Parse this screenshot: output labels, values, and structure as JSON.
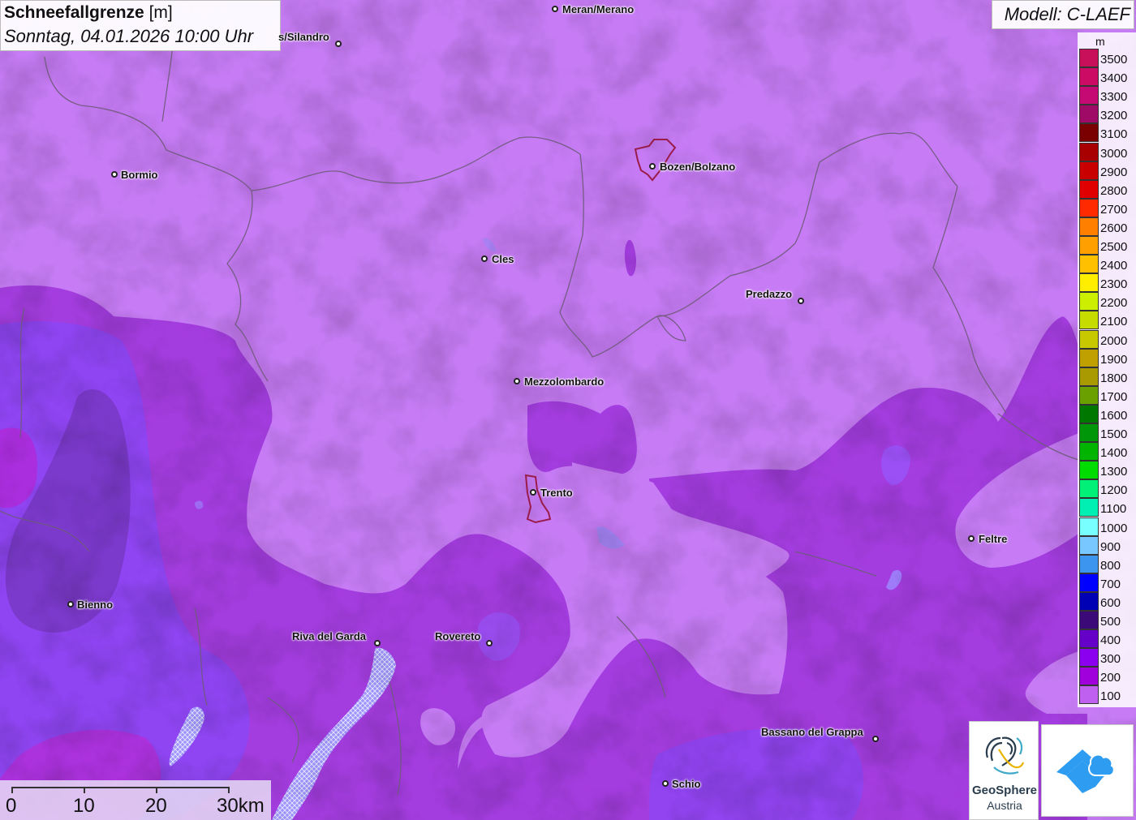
{
  "title": {
    "main": "Schneefallgrenze",
    "unit": "[m]",
    "date": "Sonntag, 04.01.2026 10:00 Uhr"
  },
  "model": {
    "label": "Modell: C-LAEF"
  },
  "legend": {
    "unit": "m",
    "items": [
      {
        "label": "3500",
        "color": "#c8105a"
      },
      {
        "label": "3400",
        "color": "#cc0c64"
      },
      {
        "label": "3300",
        "color": "#c60a74"
      },
      {
        "label": "3200",
        "color": "#9e0a66"
      },
      {
        "label": "3100",
        "color": "#7a0000"
      },
      {
        "label": "3000",
        "color": "#a80000"
      },
      {
        "label": "2900",
        "color": "#c80000"
      },
      {
        "label": "2800",
        "color": "#e00000"
      },
      {
        "label": "2700",
        "color": "#ff2a00"
      },
      {
        "label": "2600",
        "color": "#ff8000"
      },
      {
        "label": "2500",
        "color": "#ffa000"
      },
      {
        "label": "2400",
        "color": "#ffc000"
      },
      {
        "label": "2300",
        "color": "#ffee00"
      },
      {
        "label": "2200",
        "color": "#ccee00"
      },
      {
        "label": "2100",
        "color": "#c6dc00"
      },
      {
        "label": "2000",
        "color": "#c8c800"
      },
      {
        "label": "1900",
        "color": "#c0a000"
      },
      {
        "label": "1800",
        "color": "#a89a00"
      },
      {
        "label": "1700",
        "color": "#6aa000"
      },
      {
        "label": "1600",
        "color": "#007800"
      },
      {
        "label": "1500",
        "color": "#00960a"
      },
      {
        "label": "1400",
        "color": "#00b400"
      },
      {
        "label": "1300",
        "color": "#00dc00"
      },
      {
        "label": "1200",
        "color": "#00f078"
      },
      {
        "label": "1100",
        "color": "#00f0b4"
      },
      {
        "label": "1000",
        "color": "#78ffff"
      },
      {
        "label": "900",
        "color": "#78c8ff"
      },
      {
        "label": "800",
        "color": "#3c96f0"
      },
      {
        "label": "700",
        "color": "#0000ff"
      },
      {
        "label": "600",
        "color": "#0000b4"
      },
      {
        "label": "500",
        "color": "#3c0a78"
      },
      {
        "label": "400",
        "color": "#6400c8"
      },
      {
        "label": "300",
        "color": "#8c00f0"
      },
      {
        "label": "200",
        "color": "#a000dc"
      },
      {
        "label": "100",
        "color": "#c060f0"
      }
    ]
  },
  "cities": [
    {
      "name": "Meran/Merano"
    },
    {
      "name": "s/Silandro"
    },
    {
      "name": "Bormio"
    },
    {
      "name": "Bozen/Bolzano"
    },
    {
      "name": "Cles"
    },
    {
      "name": "Predazzo"
    },
    {
      "name": "Mezzolombardo"
    },
    {
      "name": "Trento"
    },
    {
      "name": "Feltre"
    },
    {
      "name": "Bienno"
    },
    {
      "name": "Riva del Garda"
    },
    {
      "name": "Rovereto"
    },
    {
      "name": "Bassano del Grappa"
    },
    {
      "name": "Schio"
    }
  ],
  "scalebar": {
    "labels": [
      "0",
      "10",
      "20",
      "30km"
    ]
  },
  "logos": {
    "geosphere_name": "GeoSphere",
    "geosphere_sub": "Austria"
  },
  "colors": {
    "band_100": "#c77cf5",
    "band_200": "#a43de0",
    "band_300": "#8c3cf0",
    "band_400": "#7a2bc0",
    "lake": "#9c8cff"
  }
}
